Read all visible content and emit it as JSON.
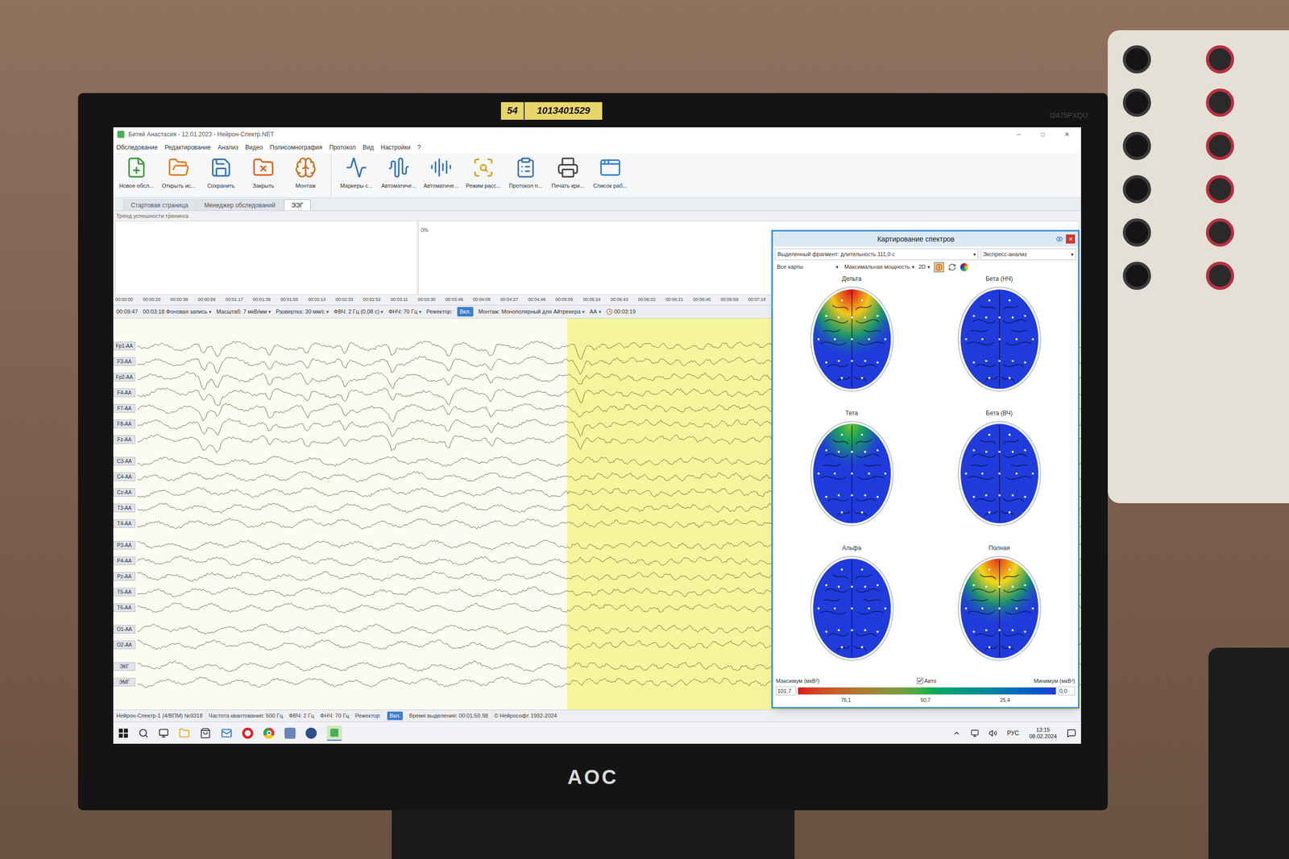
{
  "window": {
    "title": "Битей Анастасия - 12.01.2023 - Нейрон-Спектр.NET",
    "controls": [
      "─",
      "□",
      "✕"
    ]
  },
  "menu": [
    "Обследование",
    "Редактирование",
    "Анализ",
    "Видео",
    "Полисомнография",
    "Протокол",
    "Вид",
    "Настройки",
    "?"
  ],
  "toolbar_groups": [
    [
      {
        "label": "Новое обсл..."
      },
      {
        "label": "Открыть ис..."
      },
      {
        "label": "Сохранить"
      },
      {
        "label": "Закрыть"
      },
      {
        "label": "Монтаж"
      }
    ],
    [
      {
        "label": "Маркеры с..."
      },
      {
        "label": "Автоматиче..."
      },
      {
        "label": "Автоматиче..."
      },
      {
        "label": "Режим расс..."
      },
      {
        "label": "Протокол п..."
      },
      {
        "label": "Печать кри..."
      },
      {
        "label": "Список раб..."
      }
    ]
  ],
  "tabs": [
    {
      "label": "Стартовая страница",
      "selected": false
    },
    {
      "label": "Менеджер обследований",
      "selected": false
    },
    {
      "label": "ЭЭГ",
      "selected": true
    }
  ],
  "trend": {
    "title": "Тренд успешности тренинга",
    "percent": "0%",
    "times": [
      "00:00:00",
      "00:00:20",
      "00:00:39",
      "00:00:58",
      "00:01:17",
      "00:01:36",
      "00:01:55",
      "00:02:14",
      "00:02:33",
      "00:02:52",
      "00:03:11",
      "00:03:30",
      "00:03:49",
      "00:04:08",
      "00:04:27",
      "00:04:46",
      "00:05:05",
      "00:05:24",
      "00:05:43",
      "00:06:02",
      "00:06:21",
      "00:06:40",
      "00:06:59",
      "00:07:18"
    ]
  },
  "eeg_toolbar": {
    "arrow": "▾",
    "items": [
      {
        "text": "00:09:47",
        "kind": "text"
      },
      {
        "text": "00:03:18 Фоновая запись",
        "kind": "dropdown"
      },
      {
        "text": "Масштаб: 7 мкВ/мм",
        "kind": "dropdown"
      },
      {
        "text": "Развертка: 30 мм/с",
        "kind": "dropdown"
      },
      {
        "text": "ФВЧ: 2 Гц (0,08 с)",
        "kind": "dropdown"
      },
      {
        "text": "ФНЧ: 70 Гц",
        "kind": "dropdown"
      },
      {
        "text": "Режектор:",
        "kind": "text"
      },
      {
        "text": "Вкл.",
        "kind": "toggle"
      },
      {
        "text": "Монтаж: Монополярный для Айтрекера",
        "kind": "dropdown"
      },
      {
        "text": "АА",
        "kind": "dropdown"
      },
      {
        "text": "00:03:19",
        "kind": "clock"
      }
    ]
  },
  "channel_groups": [
    [
      "Fp1-AA",
      "F3-AA",
      "Fp2-AA",
      "F4-AA",
      "F7-AA",
      "F8-AA",
      "Fz-AA"
    ],
    [
      "C3-AA",
      "C4-AA",
      "Cz-AA",
      "T3-AA",
      "T4-AA"
    ],
    [
      "P3-AA",
      "P4-AA",
      "Pz-AA",
      "T5-AA",
      "T6-AA"
    ],
    [
      "O1-AA",
      "O2-AA"
    ],
    [
      "ЭКГ",
      "ЭМГ"
    ]
  ],
  "selection": {
    "start": 0.455,
    "end": 1.0
  },
  "status_bar": [
    {
      "text": "Нейрон-Спектр-1 (4/ВПМ) №9318",
      "kind": "text"
    },
    {
      "text": "Частота квантования: 500 Гц",
      "kind": "text"
    },
    {
      "text": "ФВЧ: 2 Гц",
      "kind": "text"
    },
    {
      "text": "ФНЧ: 70 Гц",
      "kind": "text"
    },
    {
      "text": "Режектор:",
      "kind": "text"
    },
    {
      "text": "Вкл.",
      "kind": "toggle"
    },
    {
      "text": "Время выделения: 00:01:50.98",
      "kind": "text"
    },
    {
      "text": "© Нейрософт 1992-2024",
      "kind": "text"
    }
  ],
  "spectral_window": {
    "title": "Картирование спектров",
    "close": "✕",
    "arrow": "▾",
    "fragment": "Выделенный фрагмент: длительность 111,0 с",
    "analysis": "Экспресс-анализ",
    "maps_filter": "Все карты",
    "measure": "Максимальная мощность",
    "mode": "2D",
    "maps": [
      {
        "label": "Дельта",
        "level": 1.0
      },
      {
        "label": "Бета (НЧ)",
        "level": 0.0
      },
      {
        "label": "Тета",
        "level": 0.5
      },
      {
        "label": "Бета (ВЧ)",
        "level": 0.0
      },
      {
        "label": "Альфа",
        "level": 0.0
      },
      {
        "label": "Полная",
        "level": 0.95
      }
    ],
    "legend": {
      "max_label": "Максимум (мкВ²)",
      "min_label": "Минимум (мкВ²)",
      "auto": {
        "label": "Авто",
        "checked": true
      },
      "max_value": "101,7",
      "min_value": "0,0",
      "ticks": [
        "76,1",
        "50,7",
        "25,4"
      ]
    }
  },
  "taskbar": {
    "language": "РУС",
    "time": "13:15",
    "date": "08.02.2024"
  },
  "monitor": {
    "sticker_number": "54",
    "sticker_code": "1013401529",
    "brand": "AOC",
    "model": "I2475PXQU"
  }
}
